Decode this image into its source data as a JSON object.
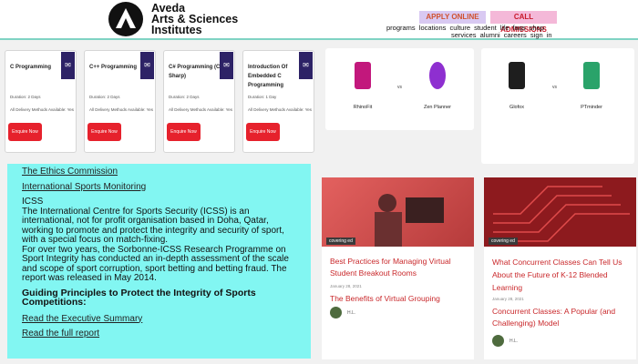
{
  "header": {
    "logo_line1": "Aveda",
    "logo_line2": "Arts & Sciences",
    "logo_line3": "Institutes",
    "apply_label": "APPLY ONLINE",
    "call_label": "CALL ADMISSIONS",
    "nav_row1": [
      "programs",
      "locations",
      "culture",
      "student life",
      "faqs",
      "shop"
    ],
    "nav_row2": [
      "services",
      "alumni",
      "careers",
      "sign in"
    ]
  },
  "courses": [
    {
      "title": "C Programming",
      "duration": "Duration: 2 Days",
      "delivery": "All Delivery Methods Available: Yes",
      "enquire": "Enquire Now"
    },
    {
      "title": "C++ Programming",
      "duration": "Duration: 2 Days",
      "delivery": "All Delivery Methods Available: Yes",
      "enquire": "Enquire Now"
    },
    {
      "title": "C# Programming (C Sharp)",
      "duration": "Duration: 2 Days",
      "delivery": "All Delivery Methods Available: Yes",
      "enquire": "Enquire Now"
    },
    {
      "title": "Introduction Of Embedded C Programming",
      "duration": "Duration: 1 Day",
      "delivery": "All Delivery Methods Available: Yes",
      "enquire": "Enquire Now"
    }
  ],
  "panel": {
    "link1": "The Ethics Commission",
    "link2": "International Sports Monitoring",
    "heading": "ICSS",
    "para1": "The International Centre for Sports Security (ICSS) is an international, not for profit organisation based in Doha, Qatar, working to promote and protect the integrity and security of sport, with a special focus on match-fixing.",
    "para2": "For over two years, the Sorbonne-ICSS Research Programme on Sport Integrity has conducted an in-depth assessment of the scale and scope of sport corruption, sport betting and betting fraud. The report was released in May 2014.",
    "subheading": "Guiding Principles to Protect the Integrity of Sports Competitions",
    "link3": "Read the Executive Summary",
    "link4": "Read the full report"
  },
  "comparisons": [
    {
      "left": "RhinoFit",
      "vs": "vs",
      "right": "Zen Planner"
    },
    {
      "left": "Glofox",
      "vs": "vs",
      "right": "PTminder"
    }
  ],
  "blogs": [
    {
      "tag": "covering ed",
      "title": "Best Practices for Managing Virtual Student Breakout Rooms",
      "date": "January 28, 2021",
      "title2": "The Benefits of Virtual Grouping",
      "author": "H.L."
    },
    {
      "tag": "covering ed",
      "title": "What Concurrent Classes Can Tell Us About the Future of K-12 Blended Learning",
      "date": "January 28, 2021",
      "title2": "Concurrent Classes: A Popular (and Challenging) Model",
      "author": "H.L."
    }
  ],
  "colors": {
    "accent_red": "#e6212c",
    "panel_cyan": "#82f6f2",
    "course_badge": "#2d2266"
  }
}
